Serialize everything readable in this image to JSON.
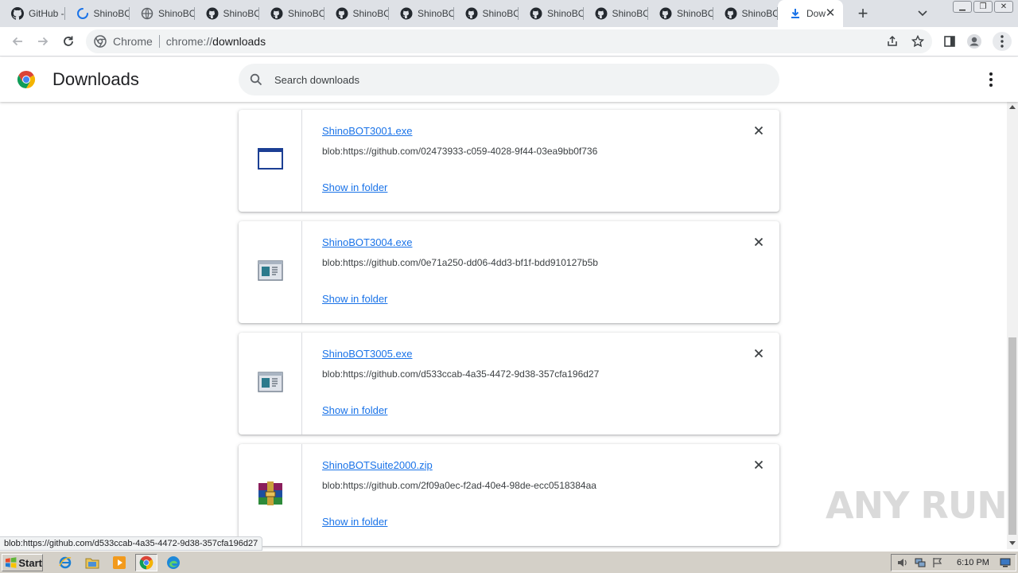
{
  "tabs": [
    {
      "label": "GitHub -",
      "icon": "github-icon"
    },
    {
      "label": "ShinoBO",
      "icon": "loading-spinner-icon"
    },
    {
      "label": "ShinoBO",
      "icon": "globe-icon"
    },
    {
      "label": "ShinoBO",
      "icon": "github-icon"
    },
    {
      "label": "ShinoBO",
      "icon": "github-icon"
    },
    {
      "label": "ShinoBO",
      "icon": "github-icon"
    },
    {
      "label": "ShinoBO",
      "icon": "github-icon"
    },
    {
      "label": "ShinoBO",
      "icon": "github-icon"
    },
    {
      "label": "ShinoBO",
      "icon": "github-icon"
    },
    {
      "label": "ShinoBO",
      "icon": "github-icon"
    },
    {
      "label": "ShinoBO",
      "icon": "github-icon"
    },
    {
      "label": "ShinoBO",
      "icon": "github-icon"
    }
  ],
  "active_tab": {
    "label": "Dow",
    "icon": "download-icon"
  },
  "omnibox": {
    "site_label": "Chrome",
    "url_scheme": "chrome://",
    "url_host": "downloads"
  },
  "page": {
    "title": "Downloads",
    "search_placeholder": "Search downloads"
  },
  "downloads": [
    {
      "filename": "ShinoBOT3001.exe",
      "url": "blob:https://github.com/02473933-c059-4028-9f44-03ea9bb0f736",
      "action": "Show in folder",
      "icon": "window-app-icon"
    },
    {
      "filename": "ShinoBOT3004.exe",
      "url": "blob:https://github.com/0e71a250-dd06-4dd3-bf1f-bdd910127b5b",
      "action": "Show in folder",
      "icon": "exe-app-icon"
    },
    {
      "filename": "ShinoBOT3005.exe",
      "url": "blob:https://github.com/d533ccab-4a35-4472-9d38-357cfa196d27",
      "action": "Show in folder",
      "icon": "exe-app-icon"
    },
    {
      "filename": "ShinoBOTSuite2000.zip",
      "url": "blob:https://github.com/2f09a0ec-f2ad-40e4-98de-ecc0518384aa",
      "action": "Show in folder",
      "icon": "winrar-archive-icon"
    }
  ],
  "status_bubble": "blob:https://github.com/d533ccab-4a35-4472-9d38-357cfa196d27",
  "watermark": "ANY RUN",
  "taskbar": {
    "start_label": "Start",
    "clock": "6:10 PM"
  },
  "colors": {
    "accent": "#1a73e8",
    "tabstrip": "#dee1e6",
    "omnibox": "#f1f3f4",
    "taskbar": "#d4d0c8"
  }
}
